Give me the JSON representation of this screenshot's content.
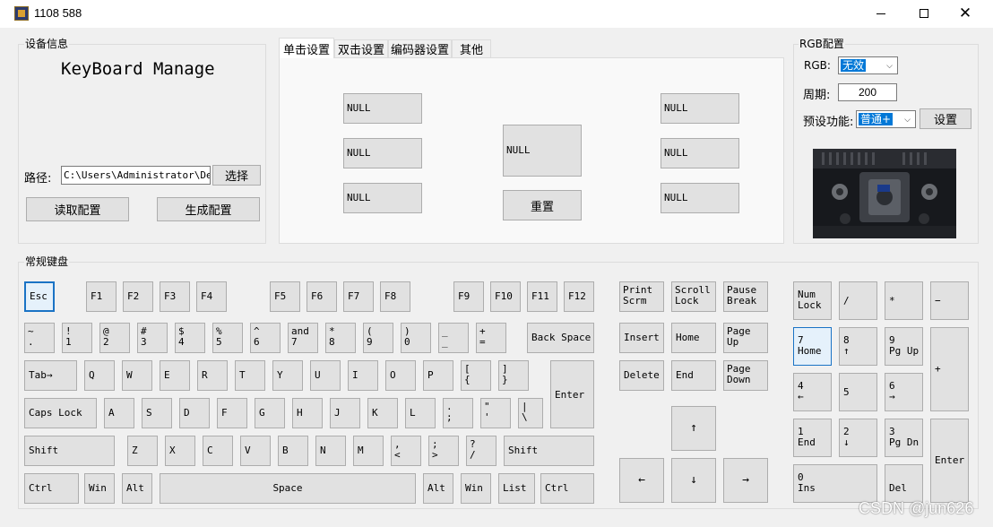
{
  "window": {
    "title": "1108 588"
  },
  "device": {
    "group_title": "设备信息",
    "heading": "KeyBoard Manage",
    "path_label": "路径:",
    "path_value": "C:\\Users\\Administrator\\Desk",
    "browse_label": "选择",
    "read_label": "读取配置",
    "generate_label": "生成配置"
  },
  "tabs": [
    "单击设置",
    "双击设置",
    "编码器设置",
    "其他"
  ],
  "keypad": {
    "slot_label": "NULL",
    "reset_label": "重置"
  },
  "rgb": {
    "group_title": "RGB配置",
    "rgb_label": "RGB:",
    "rgb_value": "无效",
    "period_label": "周期:",
    "period_value": "200",
    "preset_label": "预设功能:",
    "preset_value": "普通+",
    "set_label": "设置"
  },
  "keyboard": {
    "group_title": "常规键盘",
    "keys": {
      "esc": "Esc",
      "f1": "F1",
      "f2": "F2",
      "f3": "F3",
      "f4": "F4",
      "f5": "F5",
      "f6": "F6",
      "f7": "F7",
      "f8": "F8",
      "f9": "F9",
      "f10": "F10",
      "f11": "F11",
      "f12": "F12",
      "backtick": "~\n.",
      "k1": "!\n1",
      "k2": "@\n2",
      "k3": "#\n3",
      "k4": "$\n4",
      "k5": "%\n5",
      "k6": "^\n6",
      "k7": "and\n7",
      "k8": "*\n8",
      "k9": "(\n9",
      "k0": ")\n0",
      "minus": "_\n_",
      "equals": "+\n=",
      "backspace": "Back Space",
      "tab": "Tab→",
      "q": "Q",
      "w": "W",
      "e": "E",
      "r": "R",
      "t": "T",
      "y": "Y",
      "u": "U",
      "i": "I",
      "o": "O",
      "p": "P",
      "lbracket": "[\n{",
      "rbracket": "]\n}",
      "enter": "Enter",
      "caps": "Caps Lock",
      "a": "A",
      "s": "S",
      "d": "D",
      "f": "F",
      "g": "G",
      "h": "H",
      "j": "J",
      "k": "K",
      "l": "L",
      "semicolon": ".\n;",
      "quote": "\"\n'",
      "backslash": "|\n\\",
      "lshift": "Shift",
      "z": "Z",
      "x": "X",
      "c": "C",
      "v": "V",
      "b": "B",
      "n": "N",
      "m": "M",
      "comma": ",\n<",
      "period": ";\n>",
      "slash": "?\n/",
      "rshift": "Shift",
      "lctrl": "Ctrl",
      "lwin": "Win",
      "lalt": "Alt",
      "space": "Space",
      "ralt": "Alt",
      "rwin": "Win",
      "list": "List",
      "rctrl": "Ctrl",
      "print": "Print\nScrm",
      "scroll": "Scroll\nLock",
      "pause": "Pause\nBreak",
      "insert": "Insert",
      "home": "Home",
      "pgup": "Page\nUp",
      "delete": "Delete",
      "end": "End",
      "pgdn": "Page\nDown",
      "up": "↑",
      "left": "←",
      "down": "↓",
      "right": "→",
      "numlock": "Num\nLock",
      "numdiv": "/",
      "nummul": "*",
      "numsub": "−",
      "num7": "7\nHome",
      "num8": "8\n↑",
      "num9": "9\nPg Up",
      "numadd": "+",
      "num4": "4\n←",
      "num5": "5",
      "num6": "6\n→",
      "num1": "1\nEnd",
      "num2": "2\n↓",
      "num3": "3\nPg Dn",
      "numenter": "Enter",
      "num0": "0\nIns",
      "numdel": "Del"
    }
  },
  "watermark": "CSDN @jun626"
}
